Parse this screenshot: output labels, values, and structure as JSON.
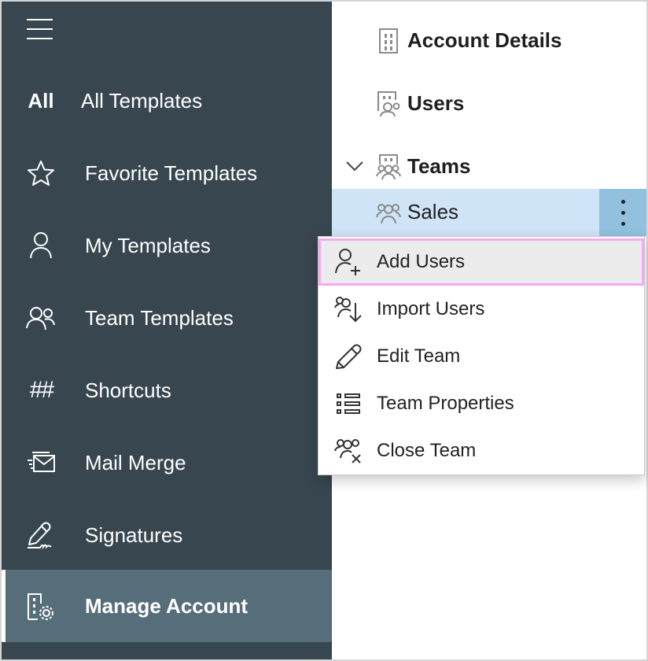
{
  "sidebar": {
    "menu_icon": "hamburger-icon",
    "items": [
      {
        "label": "All Templates",
        "icon": "all-text-icon",
        "icon_text": "All"
      },
      {
        "label": "Favorite Templates",
        "icon": "star-icon"
      },
      {
        "label": "My Templates",
        "icon": "person-icon"
      },
      {
        "label": "Team Templates",
        "icon": "people-icon"
      },
      {
        "label": "Shortcuts",
        "icon": "hash-icon",
        "icon_text": "##"
      },
      {
        "label": "Mail Merge",
        "icon": "mail-fast-icon"
      },
      {
        "label": "Signatures",
        "icon": "signature-pen-icon"
      },
      {
        "label": "Manage Account",
        "icon": "building-gear-icon",
        "active": true
      }
    ]
  },
  "account_tree": {
    "items": [
      {
        "label": "Account Details",
        "icon": "building-icon"
      },
      {
        "label": "Users",
        "icon": "building-people-icon"
      },
      {
        "label": "Teams",
        "icon": "building-team-icon",
        "expanded": true
      },
      {
        "label": "Sales",
        "icon": "team-icon",
        "selected": true
      }
    ],
    "more_icon": "more-vertical-icon"
  },
  "context_menu": {
    "items": [
      {
        "label": "Add Users",
        "icon": "person-add-icon",
        "hovered": true
      },
      {
        "label": "Import Users",
        "icon": "people-import-icon"
      },
      {
        "label": "Edit Team",
        "icon": "pencil-icon"
      },
      {
        "label": "Team Properties",
        "icon": "list-icon"
      },
      {
        "label": "Close Team",
        "icon": "people-remove-icon"
      }
    ]
  },
  "colors": {
    "sidebar_bg": "#37464f",
    "sidebar_active": "#566e7a",
    "selected_row": "#cfe4f6",
    "more_button": "#92c0df",
    "hover_outline": "#f6a8f4",
    "hover_bg": "#ececec"
  }
}
